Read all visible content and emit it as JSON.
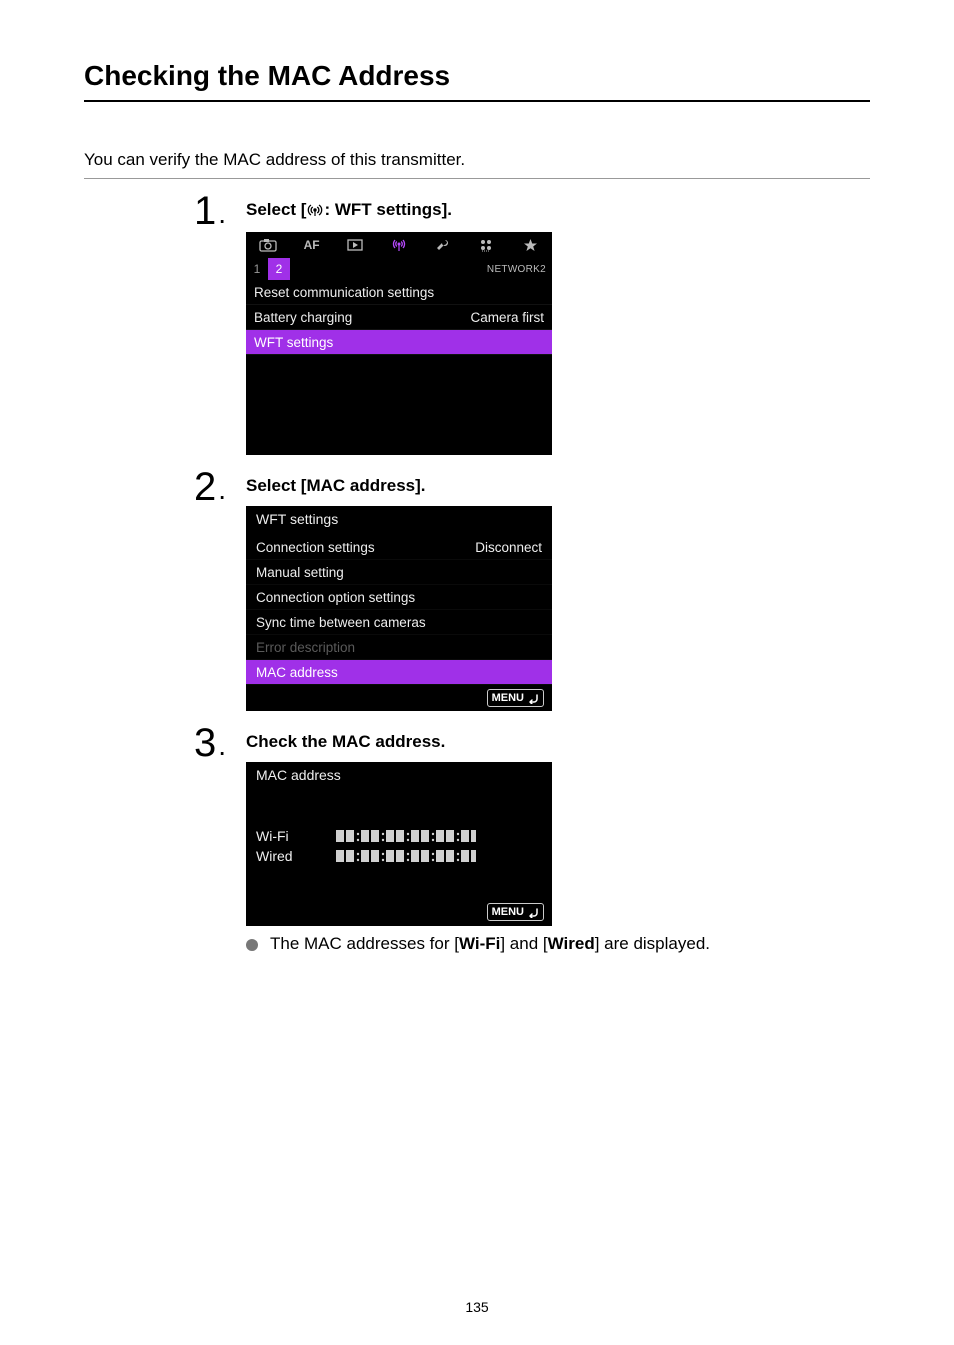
{
  "page_title": "Checking the MAC Address",
  "intro": "You can verify the MAC address of this transmitter.",
  "steps": [
    {
      "number": "1",
      "title_prefix": "Select [",
      "title_suffix": ": WFT settings].",
      "screenshot1": {
        "tabs_icons": [
          "camera",
          "AF",
          "play",
          "antenna",
          "wrench",
          "settings",
          "star"
        ],
        "subtabs": {
          "nums": [
            "1",
            "2"
          ],
          "selected_index": 1,
          "label": "NETWORK2"
        },
        "rows": [
          {
            "left": "Reset communication settings",
            "right": ""
          },
          {
            "left": "Battery charging",
            "right": "Camera first"
          },
          {
            "left": "WFT settings",
            "right": "",
            "selected": true
          }
        ]
      }
    },
    {
      "number": "2",
      "title": "Select [MAC address].",
      "screenshot2": {
        "title": "WFT settings",
        "rows": [
          {
            "left": "Connection settings",
            "right": "Disconnect"
          },
          {
            "left": "Manual setting",
            "right": ""
          },
          {
            "left": "Connection option settings",
            "right": ""
          },
          {
            "left": "Sync time between cameras",
            "right": ""
          },
          {
            "left": "Error description",
            "right": "",
            "dim": true
          },
          {
            "left": "MAC address",
            "right": "",
            "selected": true
          }
        ],
        "footer_btn": "MENU"
      }
    },
    {
      "number": "3",
      "title": "Check the MAC address.",
      "screenshot3": {
        "title": "MAC address",
        "rows": [
          {
            "label": "Wi-Fi",
            "value": "∎∎:∎∎:∎∎:∎∎:∎∎:∎∎"
          },
          {
            "label": "Wired",
            "value": "∎∎:∎∎:∎∎:∎∎:∎∎:∎∎"
          }
        ],
        "footer_btn": "MENU"
      },
      "note_parts": [
        "The MAC addresses for [",
        "Wi-Fi",
        "] and [",
        "Wired",
        "] are displayed."
      ]
    }
  ],
  "page_number": "135"
}
